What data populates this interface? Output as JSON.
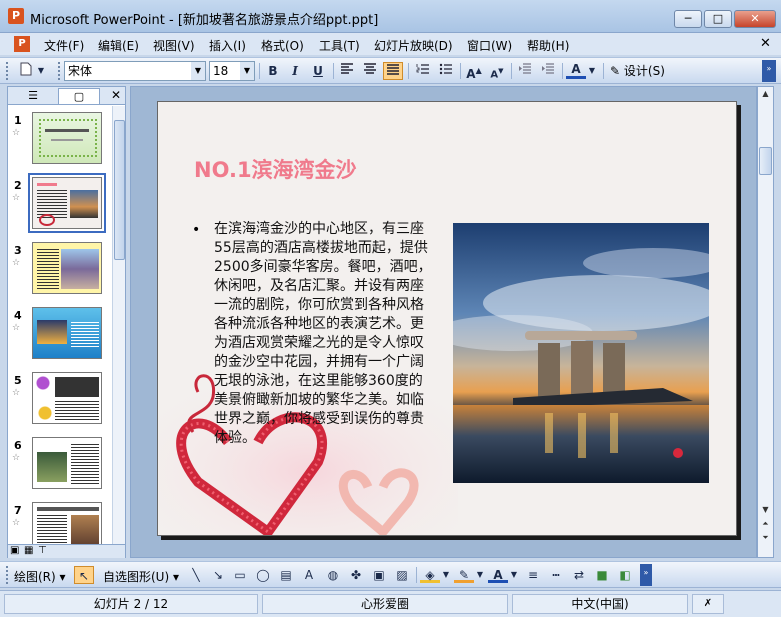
{
  "window": {
    "title": "Microsoft PowerPoint - [新加坡著名旅游景点介绍ppt.ppt]",
    "min_label": "─",
    "max_label": "□",
    "close_label": "✕"
  },
  "menu": {
    "items": [
      "文件(F)",
      "编辑(E)",
      "视图(V)",
      "插入(I)",
      "格式(O)",
      "工具(T)",
      "幻灯片放映(D)",
      "窗口(W)",
      "帮助(H)"
    ],
    "close_label": "✕"
  },
  "toolbar": {
    "font_name": "宋体",
    "font_size": "18",
    "bold_label": "B",
    "italic_label": "I",
    "underline_label": "U",
    "design_label": "设计(S)"
  },
  "left_panel": {
    "close_label": "✕",
    "slides": [
      {
        "num": "1"
      },
      {
        "num": "2"
      },
      {
        "num": "3"
      },
      {
        "num": "4"
      },
      {
        "num": "5"
      },
      {
        "num": "6"
      },
      {
        "num": "7"
      }
    ],
    "selected_slide": "2"
  },
  "slide": {
    "title": "NO.1滨海湾金沙",
    "bullet": "•",
    "body": "在滨海湾金沙的中心地区，有三座55层高的酒店高楼拔地而起，提供2500多间豪华客房。餐吧，酒吧，休闲吧，及名店汇聚。并设有两座一流的剧院，你可欣赏到各种风格各种流派各种地区的表演艺术。更为酒店观赏荣耀之光的是令人惊叹的金沙空中花园，并拥有一个广阔无垠的泳池，在这里能够360度的美景俯瞰新加坡的繁华之美。如临世界之巅，你将感受到误伤的尊贵体验。"
  },
  "drawing_toolbar": {
    "draw_label": "绘图(R)",
    "autoshapes_label": "自选图形(U)"
  },
  "status": {
    "slide_info": "幻灯片 2 / 12",
    "design_name": "心形爱圈",
    "language": "中文(中国)"
  },
  "colors": {
    "title_pink": "#f07a8c",
    "accent_blue": "#3c6bc0"
  }
}
